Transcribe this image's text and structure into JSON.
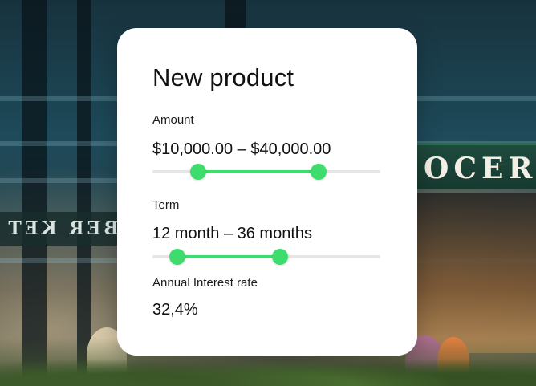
{
  "card": {
    "title": "New product"
  },
  "amount": {
    "label": "Amount",
    "value": "$10,000.00 – $40,000.00",
    "slider": {
      "low_fraction": 0.2,
      "high_fraction": 0.73
    }
  },
  "term": {
    "label": "Term",
    "value": "12 month – 36 months",
    "slider": {
      "low_fraction": 0.11,
      "high_fraction": 0.56
    }
  },
  "rate": {
    "label": "Annual Interest rate",
    "value": "32,4%"
  },
  "colors": {
    "accent": "#3ddc6d",
    "track": "#e6e6e6",
    "card_background": "#ffffff"
  }
}
